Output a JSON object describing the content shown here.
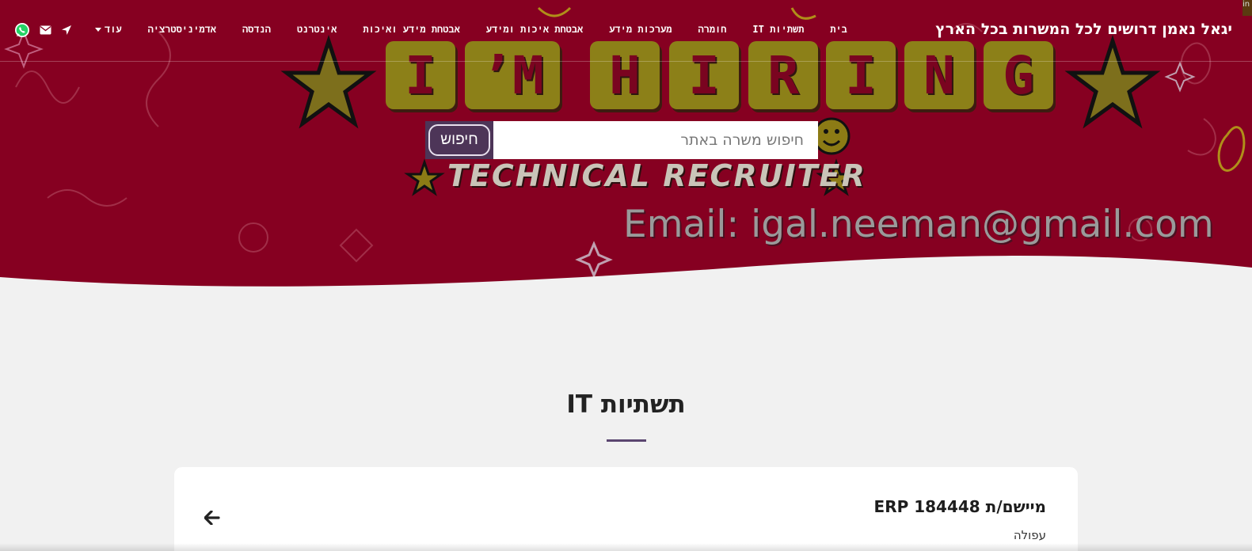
{
  "brand": {
    "title": "יגאל נאמן דרושים לכל המשרות בכל הארץ"
  },
  "nav": {
    "items": [
      "בית",
      "תשתיות IT",
      "חומרה",
      "מערכות מידע",
      "אבטחת איכות ומידע",
      "אבטחת מידע ואיכות",
      "אינטרנט",
      "הנדסה",
      "אדמיניסטרציה"
    ],
    "more_label": "עוד"
  },
  "social": {
    "icons": [
      "location-arrow-icon",
      "envelope-icon",
      "whatsapp-icon"
    ],
    "whatsapp_color": "#25d366"
  },
  "hero": {
    "letters": [
      "I",
      "’M",
      "H",
      "I",
      "R",
      "I",
      "N",
      "G"
    ],
    "tagline": "TECHNICAL RECRUITER",
    "email": "Email: igal.neeman@gmail.com",
    "background_color": "#860021",
    "tile_color": "#8c8018",
    "corner_text": "in"
  },
  "search": {
    "placeholder": "חיפוש משרה באתר",
    "button_label": "חיפוש",
    "button_color": "#4d3558"
  },
  "main": {
    "title": "תשתיות IT",
    "accent_color": "#5b4670",
    "job": {
      "title": "מיישם/ת ERP 184448",
      "location": "עפולה"
    }
  }
}
